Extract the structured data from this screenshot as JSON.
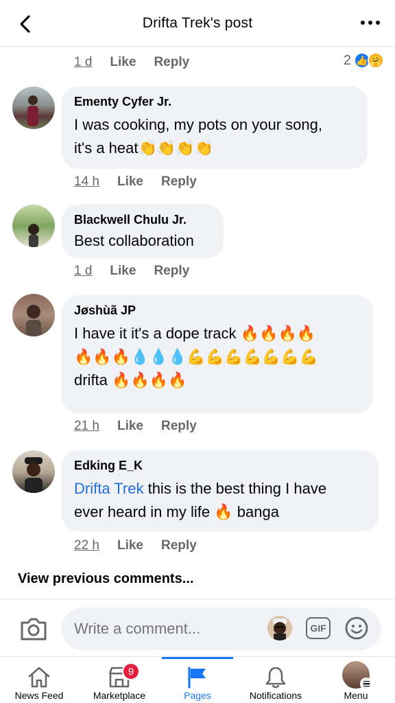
{
  "header": {
    "title": "Drifta Trek's post"
  },
  "top_comment": {
    "time": "1 d",
    "like": "Like",
    "reply": "Reply",
    "reaction_count": "2"
  },
  "comments": [
    {
      "author": "Ementy Cyfer Jr.",
      "line1": "I was cooking, my pots on your song,",
      "line2": "it's a heat",
      "line2_emoji": "👏👏👏👏",
      "time": "14 h",
      "like": "Like",
      "reply": "Reply"
    },
    {
      "author": "Blackwell Chulu Jr.",
      "line1": "Best collaboration",
      "time": "1 d",
      "like": "Like",
      "reply": "Reply"
    },
    {
      "author": "Jøshùã JP",
      "line1": "I have it it's a dope track",
      "line1_emoji": "🔥🔥🔥🔥",
      "line2_emoji": "🔥🔥🔥💧💧💧💪💪💪💪💪💪💪",
      "line3": "drifta",
      "line3_emoji": "🔥🔥🔥🔥",
      "time": "21 h",
      "like": "Like",
      "reply": "Reply"
    },
    {
      "author": "Edking E_K",
      "mention": "Drifta Trek",
      "line1": " this is the best thing I have",
      "line2": "ever heard in my life",
      "line2_emoji": "🔥",
      "line2_end": "banga",
      "time": "22 h",
      "like": "Like",
      "reply": "Reply"
    }
  ],
  "view_previous": "View previous comments...",
  "composer": {
    "placeholder": "Write a comment...",
    "gif_label": "GIF"
  },
  "tabs": [
    {
      "label": "News Feed"
    },
    {
      "label": "Marketplace",
      "badge": "9"
    },
    {
      "label": "Pages"
    },
    {
      "label": "Notifications"
    },
    {
      "label": "Menu"
    }
  ],
  "colors": {
    "accent": "#1877f2",
    "badge": "#e41e3f",
    "bubble": "#f0f2f5"
  }
}
